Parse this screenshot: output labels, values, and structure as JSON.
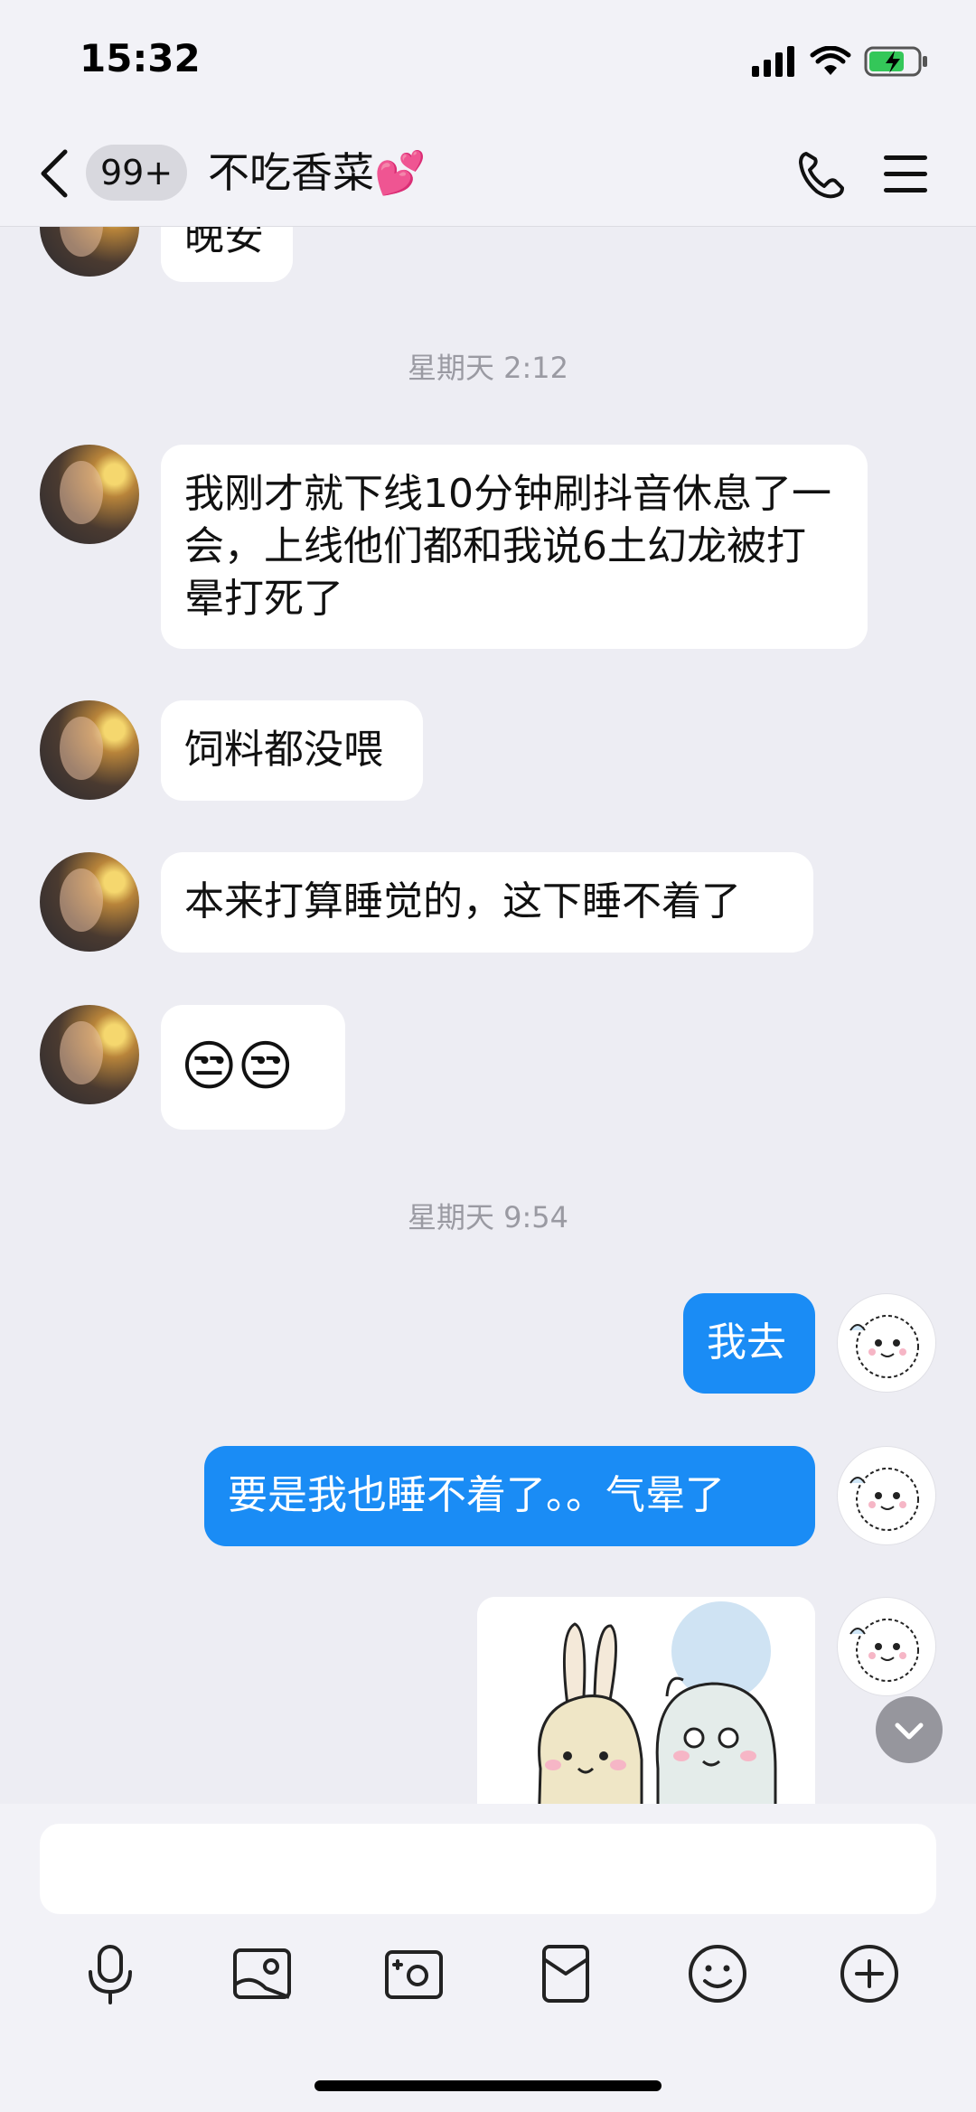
{
  "status_bar": {
    "time": "15:32"
  },
  "header": {
    "unread_count": "99+",
    "chat_title": "不吃香菜💕"
  },
  "messages": {
    "partial_top": "晚安",
    "timestamp_1": "星期天 2:12",
    "her_1": "我刚才就下线10分钟刷抖音休息了一会，上线他们都和我说6土幻龙被打晕打死了",
    "her_2": "饲料都没喂",
    "her_3": "本来打算睡觉的，这下睡不着了",
    "her_4": "😒😒",
    "timestamp_2": "星期天 9:54",
    "me_1": "我去",
    "me_2": "要是我也睡不着了。。气晕了"
  },
  "input": {
    "value": "",
    "placeholder": ""
  },
  "toolbar": [
    "microphone-icon",
    "image-icon",
    "camera-icon",
    "red-packet-icon",
    "emoji-icon",
    "plus-icon"
  ],
  "colors": {
    "my_bubble": "#1a8cf5",
    "background": "#ededf3",
    "header": "#f2f2f7"
  }
}
